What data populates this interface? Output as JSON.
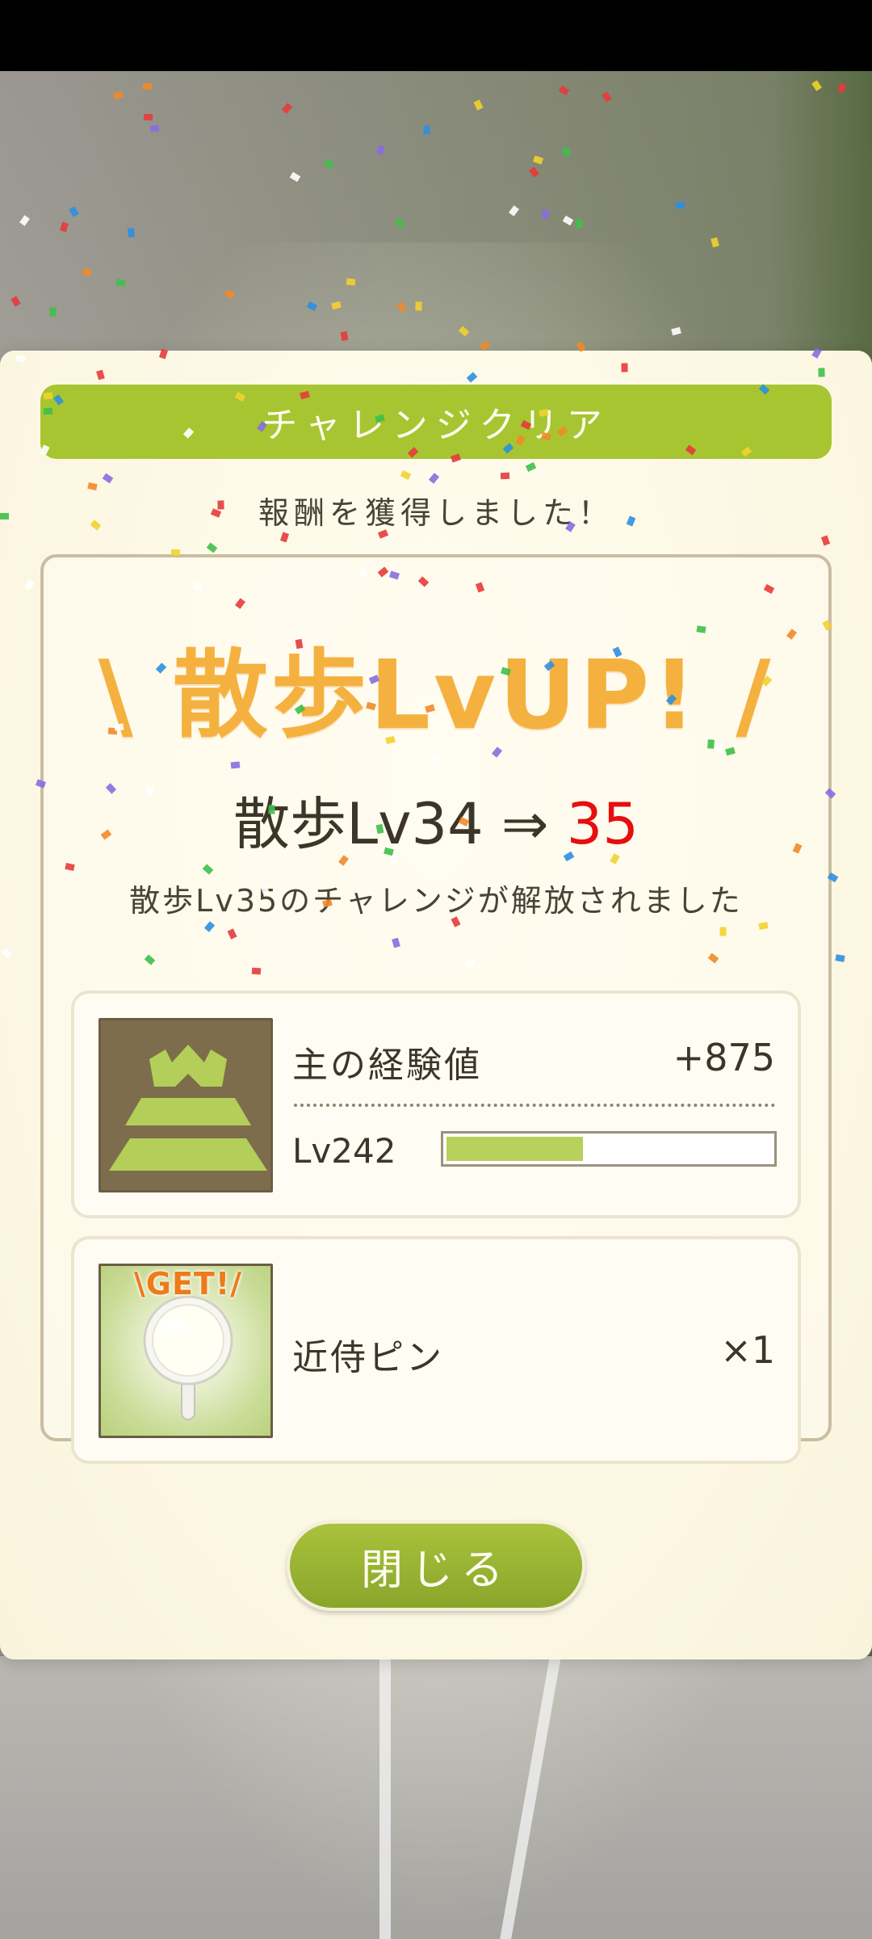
{
  "modal": {
    "banner_title": "チャレンジクリア",
    "subtitle": "報酬を獲得しました！",
    "lvup_headline": "\\ 散歩LvUP! /",
    "level_change": {
      "from_label": "散歩Lv34 ⇒ ",
      "to_value": "35"
    },
    "unlock_message": "散歩Lv35のチャレンジが解放されました",
    "exp_reward": {
      "label": "主の経験値",
      "value": "+875",
      "level_label": "Lv242",
      "progress_fraction": 0.42
    },
    "item_reward": {
      "badge": "\\GET!/",
      "label": "近侍ピン",
      "count": "×1"
    },
    "close_button_label": "閉じる"
  },
  "colors": {
    "banner_green": "#a7c531",
    "headline_orange": "#f5b13f",
    "new_level_red": "#e60e0e",
    "exp_bar_green": "#b7d15a",
    "modal_bg": "#fdf9ec"
  },
  "icons": {
    "exp_icon": "castle-icon",
    "item_icon": "pin-icon"
  }
}
